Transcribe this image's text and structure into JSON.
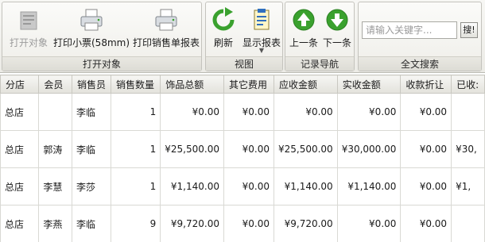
{
  "ribbon": {
    "groups": [
      {
        "label": "打开对象",
        "buttons": [
          {
            "label": "打开对象",
            "icon": "open-object-icon",
            "enabled": false
          },
          {
            "label": "打印小票(58mm)",
            "icon": "printer-icon",
            "enabled": true
          },
          {
            "label": "打印销售单报表",
            "icon": "printer-icon",
            "enabled": true
          }
        ]
      },
      {
        "label": "视图",
        "buttons": [
          {
            "label": "刷新",
            "icon": "refresh-icon",
            "enabled": true
          },
          {
            "label": "显示报表",
            "icon": "report-icon",
            "enabled": true
          }
        ]
      },
      {
        "label": "记录导航",
        "buttons": [
          {
            "label": "上一条",
            "icon": "arrow-up-icon",
            "enabled": true
          },
          {
            "label": "下一条",
            "icon": "arrow-down-icon",
            "enabled": true
          }
        ]
      },
      {
        "label": "全文搜索",
        "search": {
          "placeholder": "请输入关键字...",
          "button_label": "搜!"
        }
      }
    ]
  },
  "colors": {
    "green_icon": "#3aa12e",
    "printer_body": "#d9dde2",
    "accent_border": "#c4c3bd"
  },
  "table": {
    "columns": [
      "分店",
      "会员",
      "销售员",
      "销售数量",
      "饰品总额",
      "其它费用",
      "应收金额",
      "实收金额",
      "收款折让",
      "已收:"
    ],
    "rows": [
      [
        "总店",
        "",
        "李临",
        "1",
        "¥0.00",
        "¥0.00",
        "¥0.00",
        "¥0.00",
        "¥0.00",
        ""
      ],
      [
        "总店",
        "郭涛",
        "李临",
        "1",
        "¥25,500.00",
        "¥0.00",
        "¥25,500.00",
        "¥30,000.00",
        "¥0.00",
        "¥30,"
      ],
      [
        "总店",
        "李慧",
        "李莎",
        "1",
        "¥1,140.00",
        "¥0.00",
        "¥1,140.00",
        "¥1,140.00",
        "¥0.00",
        "¥1,"
      ],
      [
        "总店",
        "李燕",
        "李临",
        "9",
        "¥9,720.00",
        "¥0.00",
        "¥9,720.00",
        "¥0.00",
        "¥0.00",
        ""
      ]
    ]
  }
}
